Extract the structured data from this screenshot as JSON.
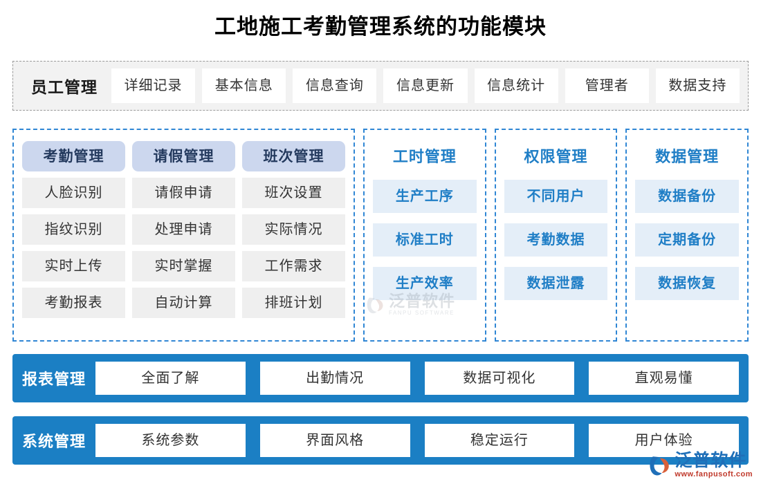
{
  "title": "工地施工考勤管理系统的功能模块",
  "colors": {
    "accent_blue": "#1b7fc4",
    "panel_border_blue": "#2f86d4",
    "head_chip_bg": "#ccd7ee",
    "item_chip_gray": "#efefef",
    "item_chip_blue": "#e4eef8",
    "top_bar_bg": "#f2f2f2"
  },
  "top_bar": {
    "label": "员工管理",
    "items": [
      "详细记录",
      "基本信息",
      "信息查询",
      "信息更新",
      "信息统计",
      "管理者",
      "数据支持"
    ]
  },
  "panels": [
    {
      "type": "multi-column",
      "columns": [
        {
          "header": "考勤管理",
          "items": [
            "人脸识别",
            "指纹识别",
            "实时上传",
            "考勤报表"
          ]
        },
        {
          "header": "请假管理",
          "items": [
            "请假申请",
            "处理申请",
            "实时掌握",
            "自动计算"
          ]
        },
        {
          "header": "班次管理",
          "items": [
            "班次设置",
            "实际情况",
            "工作需求",
            "排班计划"
          ]
        }
      ]
    },
    {
      "type": "single-column",
      "header": "工时管理",
      "items": [
        "生产工序",
        "标准工时",
        "生产效率"
      ]
    },
    {
      "type": "single-column",
      "header": "权限管理",
      "items": [
        "不同用户",
        "考勤数据",
        "数据泄露"
      ]
    },
    {
      "type": "single-column",
      "header": "数据管理",
      "items": [
        "数据备份",
        "定期备份",
        "数据恢复"
      ]
    }
  ],
  "bottom_bars": [
    {
      "label": "报表管理",
      "items": [
        "全面了解",
        "出勤情况",
        "数据可视化",
        "直观易懂"
      ]
    },
    {
      "label": "系统管理",
      "items": [
        "系统参数",
        "界面风格",
        "稳定运行",
        "用户体验"
      ]
    }
  ],
  "watermarks": {
    "center": {
      "name": "泛普软件",
      "sub": "FANPU SOFTWARE"
    },
    "corner": {
      "name": "泛普软件",
      "sub": "www.fanpusoft.com"
    }
  }
}
